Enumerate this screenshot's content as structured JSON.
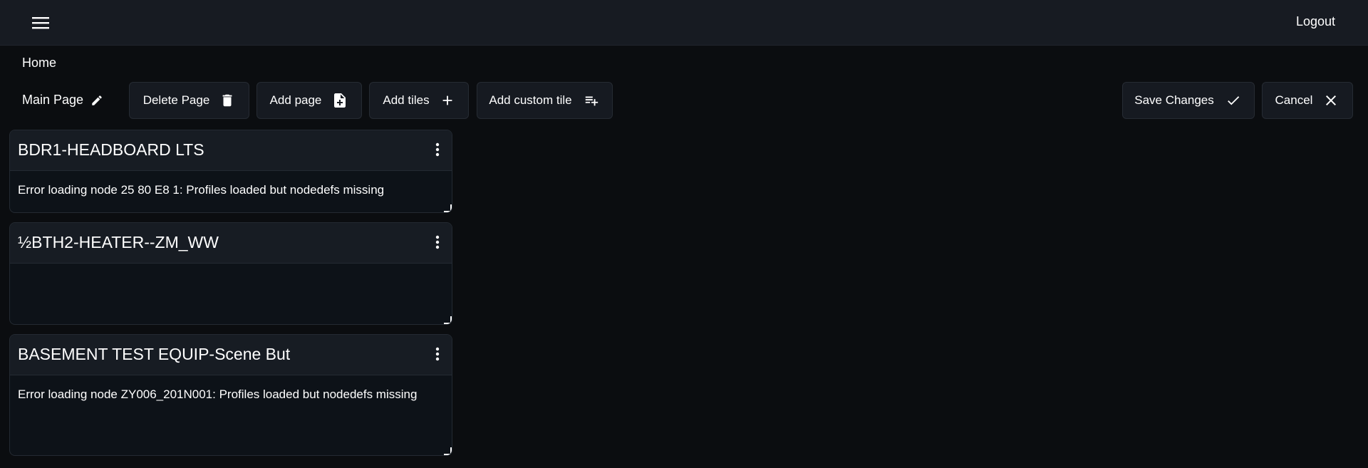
{
  "header": {
    "menu_icon": "hamburger-menu-icon",
    "logout_label": "Logout"
  },
  "breadcrumb": {
    "home": "Home"
  },
  "toolbar": {
    "page_name": "Main Page",
    "delete_page_label": "Delete Page",
    "add_page_label": "Add page",
    "add_tiles_label": "Add tiles",
    "add_custom_tile_label": "Add custom tile",
    "save_changes_label": "Save Changes",
    "cancel_label": "Cancel"
  },
  "tiles": [
    {
      "title": "BDR1-HEADBOARD LTS",
      "message": "Error loading node 25 80 E8 1: Profiles loaded but nodedefs missing"
    },
    {
      "title": "½BTH2-HEATER--ZM_WW",
      "message": ""
    },
    {
      "title": "BASEMENT TEST EQUIP-Scene But",
      "message": "Error loading node ZY006_201N001: Profiles loaded but nodedefs missing"
    }
  ],
  "colors": {
    "background": "#0b0d10",
    "topbar": "#171b22",
    "button": "#161a21",
    "tile_header": "#171c23",
    "tile_body": "#0d1218",
    "text": "#ffffff"
  }
}
